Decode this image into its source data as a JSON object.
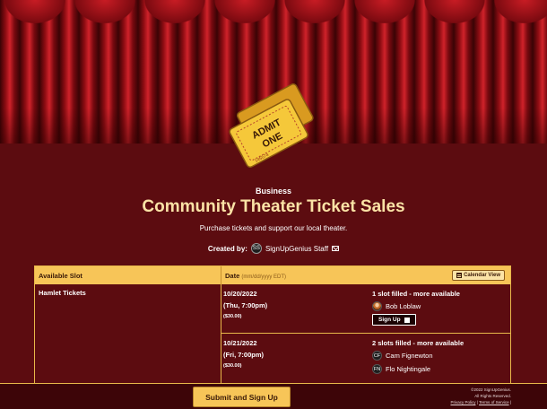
{
  "header": {
    "organization": "Business",
    "title": "Community Theater Ticket Sales",
    "description": "Purchase tickets and support our local theater.",
    "created_by_label": "Created by:",
    "creator_initials": "SS",
    "creator_name": "SignUpGenius Staff"
  },
  "ticket_art": {
    "line1": "ADMIT",
    "line2": "ONE",
    "serial": "145574"
  },
  "table": {
    "col_slot": "Available Slot",
    "col_date": "Date",
    "date_format": "(mm/dd/yyyy EDT)",
    "calendar_view_label": "Calendar View",
    "slot_name": "Hamlet Tickets",
    "rows": [
      {
        "date": "10/20/2022",
        "time": "(Thu, 7:00pm)",
        "price": "($30.00)",
        "status": "1 slot filled - more available",
        "people": [
          {
            "initials": "",
            "name": "Bob Loblaw"
          }
        ],
        "signup_label": "Sign Up"
      },
      {
        "date": "10/21/2022",
        "time": "(Fri, 7:00pm)",
        "price": "($30.00)",
        "status": "2 slots filled - more available",
        "people": [
          {
            "initials": "CF",
            "name": "Cam Fignewton"
          },
          {
            "initials": "FN",
            "name": "Flo Nightingale"
          }
        ]
      }
    ]
  },
  "footer": {
    "submit_label": "Submit and Sign Up",
    "copyright": "©2022 SignUpGenius.",
    "rights": "All Rights Reserved.",
    "privacy": "Privacy Policy",
    "terms": "Terms of Service"
  },
  "colors": {
    "background": "#5c0c10",
    "accent": "#f7c558",
    "title": "#fbe3a6"
  }
}
